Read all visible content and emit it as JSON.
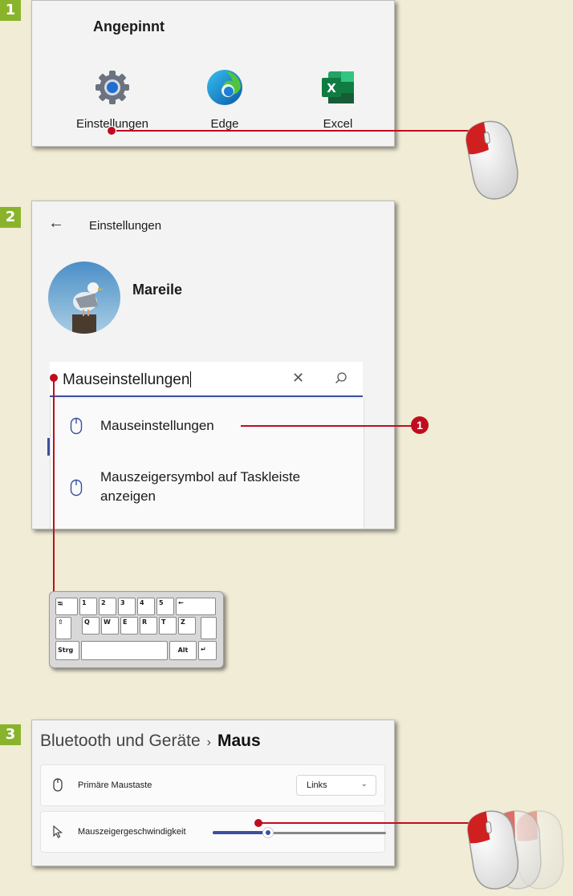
{
  "steps": [
    "1",
    "2",
    "3"
  ],
  "panel1": {
    "section_title": "Angepinnt",
    "apps": [
      {
        "label": "Einstellungen",
        "icon": "settings-gear-icon"
      },
      {
        "label": "Edge",
        "icon": "edge-icon"
      },
      {
        "label": "Excel",
        "icon": "excel-icon"
      }
    ]
  },
  "panel2": {
    "title": "Einstellungen",
    "user_name": "Mareile",
    "search_value": "Mauseinstellungen",
    "suggestions": [
      {
        "label": "Mauseinstellungen"
      },
      {
        "label_line1": "Mauszeigersymbol auf Taskleiste",
        "label_line2": "anzeigen"
      }
    ],
    "callout_number": "1"
  },
  "keyboard": {
    "row1": [
      "1",
      "2",
      "3",
      "4",
      "5"
    ],
    "row2": [
      "Q",
      "W",
      "E",
      "R",
      "T",
      "Z"
    ],
    "ctrl_label": "Strg",
    "alt_label": "Alt"
  },
  "panel3": {
    "breadcrumb_parent": "Bluetooth und Geräte",
    "breadcrumb_separator": "›",
    "breadcrumb_current": "Maus",
    "primary_button_label": "Primäre Maustaste",
    "primary_button_value": "Links",
    "pointer_speed_label": "Mauszeigergeschwindigkeit",
    "pointer_speed_level": 0.32
  },
  "colors": {
    "accent_green": "#8ab32c",
    "callout_red": "#c00d1e",
    "windows_accent": "#3b4ea0"
  }
}
